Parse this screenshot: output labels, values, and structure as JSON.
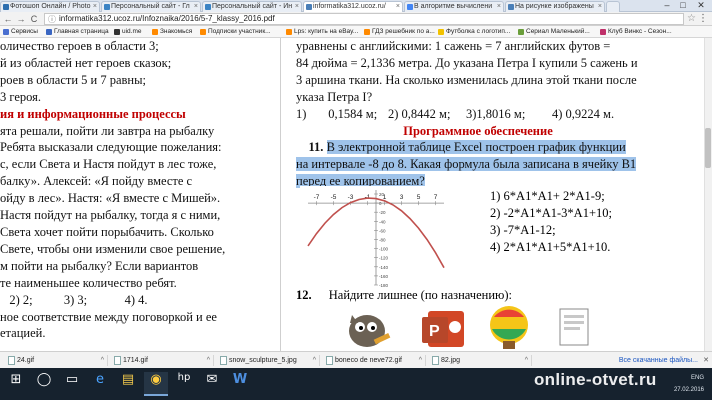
{
  "tabs": [
    {
      "label": "Фотошоп Онлайн / Photo",
      "color": "#2d6fb0"
    },
    {
      "label": "Персональный сайт - Гл",
      "color": "#3b83c4"
    },
    {
      "label": "Персональный сайт - Ин",
      "color": "#3b83c4"
    },
    {
      "label": "informatika312.ucoz.ru/",
      "color": "#4a7fb8"
    },
    {
      "label": "В алгоритме вычислени",
      "color": "#4285f4"
    },
    {
      "label": "На рисунке изображены",
      "color": "#4a7fb8"
    }
  ],
  "window_controls": {
    "minimize": "–",
    "maximize": "□",
    "close": "✕"
  },
  "address": {
    "url": "informatika312.ucoz.ru/Infoznaika/2016/5-7_klassy_2016.pdf",
    "back": "←",
    "forward": "→",
    "reload": "C",
    "star": "☆",
    "menu": "⋮"
  },
  "bookmarks": [
    {
      "label": "Сервисы",
      "color": "#4a6fd0"
    },
    {
      "label": "Главная страница",
      "color": "#3a66c2"
    },
    {
      "label": "uid.me",
      "color": "#333"
    },
    {
      "label": "Знакомься",
      "color": "#ff8a00"
    },
    {
      "label": "Подписки участник...",
      "color": "#ff8a00"
    },
    {
      "label": "Lps: купить на eBay...",
      "color": "#ff8a00"
    },
    {
      "label": "ГДЗ решебник по а...",
      "color": "#ff8a00"
    },
    {
      "label": "Футболка с логотип...",
      "color": "#f2c200"
    },
    {
      "label": "Сериал Маленький...",
      "color": "#6a9e3a"
    },
    {
      "label": "Клуб Винкс - Сезон...",
      "color": "#c0306a"
    }
  ],
  "left_lines": [
    "оличество героев в области 3;",
    "й из областей нет героев сказок;",
    "роев в области 5 и 7 равны;",
    "3 героя.",
    "ия и информационные процессы",
    "ята решали, пойти ли завтра на рыбалку",
    "Ребята высказали следующие пожелания:",
    "с, если Света и Настя пойдут в лес тоже,",
    "балку». Алексей: «Я пойду вместе с",
    "ойду в лес». Настя: «Я вместе с Мишей».",
    " Настя пойдут на рыбалку, тогда я с ними,",
    " Света хочет пойти порыбачить. Сколько",
    "Свете, чтобы они изменили свое решение,",
    "м пойти на рыбалку? Если вариантов",
    "те наименьшее количество ребят.",
    "   2) 2;          3) 3;            4) 4.",
    "ное соответствие между поговоркой и ее",
    "етацией."
  ],
  "right": {
    "line1": "уравнены с английскими: 1 сажень = 7 английских футов =",
    "line2": "84 дюйма = 2,1336 метра. До указана Петра I купили 5 сажень и",
    "line3": "3 аршина ткани. На сколько изменилась длина этой ткани после",
    "line4": "указа Петра I?",
    "answers": [
      "1)       0,1584 м;",
      "2) 0,8442 м;",
      "3)1,8016 м;",
      "4) 0,9224 м."
    ],
    "section": "Программное обеспечение",
    "q11_num": "11.",
    "q11_a": "В электронной таблице Excel построен график функции",
    "q11_b": "на интервале -8 до 8. Какая формула была записана в ячейку B1",
    "q11_c": "перед ее копированием?",
    "options": [
      "1)   6*A1*A1+ 2*A1-9;",
      "2)   -2*A1*A1-3*A1+10;",
      "3)   -7*A1-12;",
      "4)   2*A1*A1+5*A1+10."
    ],
    "q12_num": "12.",
    "q12_text": "Найдите лишнее (по назначению):"
  },
  "chart_data": {
    "type": "line",
    "title": "",
    "xlabel": "",
    "ylabel": "",
    "x_ticks": [
      "-7",
      "-5",
      "-3",
      "-1",
      "1",
      "3",
      "5",
      "7"
    ],
    "y_ticks": [
      "20",
      "0",
      "-20",
      "-40",
      "-60",
      "-80",
      "-100",
      "-120",
      "-140",
      "-160",
      "-180"
    ],
    "xlim": [
      -8,
      8
    ],
    "ylim": [
      -180,
      20
    ],
    "grid": false,
    "series": [
      {
        "x": [
          -8,
          -7,
          -6,
          -5,
          -4,
          -3,
          -2,
          -1,
          0,
          1,
          2,
          3,
          4,
          5,
          6,
          7,
          8
        ],
        "y": [
          -94,
          -67,
          -44,
          -25,
          -10,
          1,
          8,
          11,
          10,
          5,
          -4,
          -17,
          -34,
          -55,
          -80,
          -109,
          -142
        ],
        "color": "#c0504d"
      }
    ]
  },
  "downloads": [
    {
      "label": "24.gif"
    },
    {
      "label": "1714.gif"
    },
    {
      "label": "snow_sculpture_5.jpg"
    },
    {
      "label": "boneco de neve72.gif"
    },
    {
      "label": "82.jpg"
    }
  ],
  "downloads_all": "Все скачанные файлы...",
  "taskbar_apps": [
    "⊞",
    "◯",
    "▭",
    "e",
    "▤",
    "◉",
    "hp",
    "✉",
    "W"
  ],
  "tray": {
    "lang": "ENG",
    "date": "27.02.2016"
  },
  "watermark": "online-otvet.ru"
}
